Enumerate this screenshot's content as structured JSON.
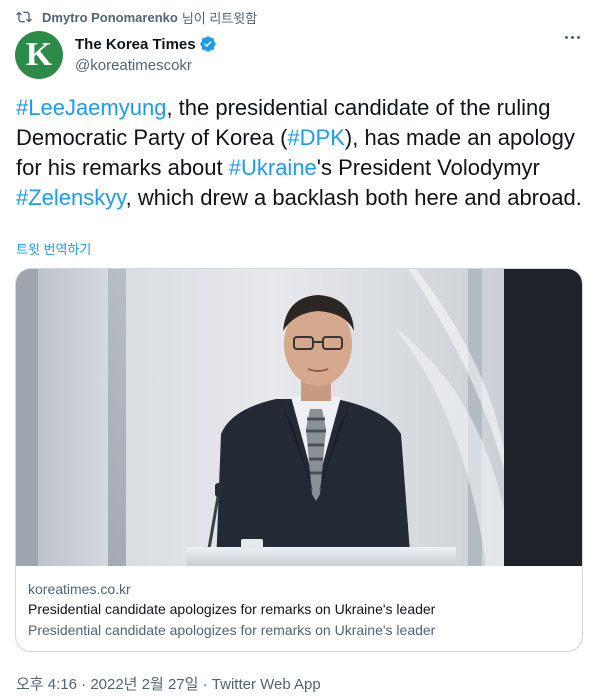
{
  "retweet": {
    "user": "Dmytro Ponomarenko",
    "suffix": "님이 리트윗함",
    "icon": "retweet-icon"
  },
  "author": {
    "avatar_letter": "K",
    "avatar_color": "#2d8a47",
    "name": "The Korea Times",
    "handle": "@koreatimescokr",
    "verified_icon": "verified-badge-icon",
    "verified_color": "#1d9bf0"
  },
  "tweet": {
    "segments": [
      {
        "text": "#LeeJaemyung",
        "link": true
      },
      {
        "text": ", the presidential candidate of the ruling Democratic Party of Korea (",
        "link": false
      },
      {
        "text": "#DPK",
        "link": true
      },
      {
        "text": "), has made an apology for his remarks about ",
        "link": false
      },
      {
        "text": "#Ukraine",
        "link": true
      },
      {
        "text": "'s President Volodymyr ",
        "link": false
      },
      {
        "text": "#Zelenskyy",
        "link": true
      },
      {
        "text": ", which drew a backlash both here and abroad.",
        "link": false
      }
    ],
    "translate_label": "트윗 번역하기",
    "link_color": "#1d9bf0"
  },
  "card": {
    "domain": "koreatimes.co.kr",
    "title": "Presidential candidate apologizes for remarks on Ukraine's leader",
    "description": "Presidential candidate apologizes for remarks on Ukraine's leader"
  },
  "footer": {
    "time": "오후 4:16",
    "date": "2022년 2월 27일",
    "source": "Twitter Web App",
    "separator": "·"
  }
}
